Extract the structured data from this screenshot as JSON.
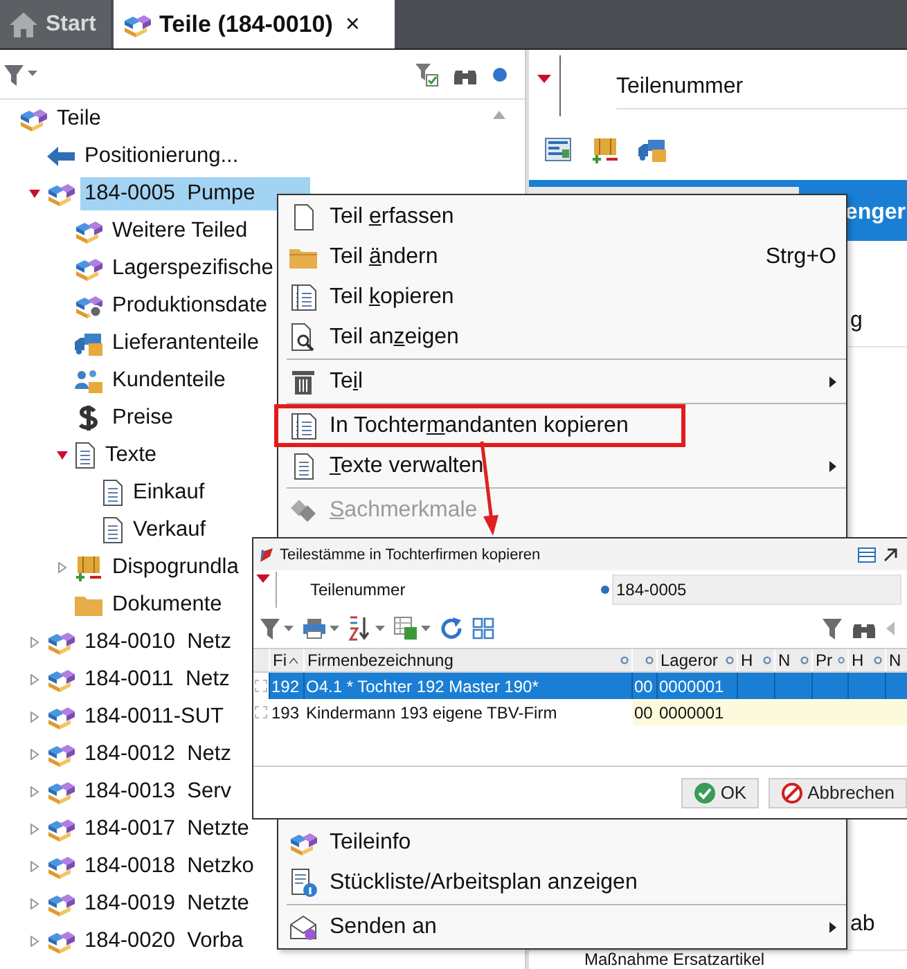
{
  "tabs": [
    {
      "label": "Start",
      "selected": false,
      "kind": "home"
    },
    {
      "label": "Teile (184-0010)",
      "selected": true,
      "kind": "parts",
      "close": "×"
    }
  ],
  "tree": {
    "root": {
      "label": "Teile",
      "kind": "part",
      "selected": false,
      "children": [
        {
          "label": "Positionierung...",
          "kind": "position",
          "selected": false
        },
        {
          "label": "184-0005  Pumpe",
          "kind": "part",
          "selected": true,
          "expanded": true,
          "children": [
            {
              "label": "Weitere Teiled",
              "kind": "part",
              "selected": false
            },
            {
              "label": "Lagerspezifische",
              "kind": "part",
              "selected": false
            },
            {
              "label": "Produktionsdate",
              "kind": "production",
              "selected": false
            },
            {
              "label": "Lieferantenteile",
              "kind": "supplier",
              "selected": false
            },
            {
              "label": "Kundenteile",
              "kind": "customer",
              "selected": false
            },
            {
              "label": "Preise",
              "kind": "prices",
              "selected": false
            },
            {
              "label": "Texte",
              "kind": "texts",
              "selected": false,
              "expanded": true,
              "children": [
                {
                  "label": "Einkauf",
                  "kind": "text",
                  "selected": false
                },
                {
                  "label": "Verkauf",
                  "kind": "text",
                  "selected": false
                }
              ]
            },
            {
              "label": "Dispogrundla",
              "kind": "dispo",
              "selected": false,
              "expanded": false
            },
            {
              "label": "Dokumente",
              "kind": "folder",
              "selected": false
            }
          ]
        },
        {
          "label": "184-0010  Netz",
          "kind": "part",
          "selected": false,
          "expanded": false
        },
        {
          "label": "184-0011  Netz",
          "kind": "part",
          "selected": false,
          "expanded": false
        },
        {
          "label": "184-0011-SUT",
          "kind": "part",
          "selected": false,
          "expanded": false
        },
        {
          "label": "184-0012  Netz",
          "kind": "part",
          "selected": false,
          "expanded": false
        },
        {
          "label": "184-0013  Serv",
          "kind": "part",
          "selected": false,
          "expanded": false
        },
        {
          "label": "184-0017  Netzte",
          "kind": "part",
          "selected": false,
          "expanded": false
        },
        {
          "label": "184-0018  Netzko",
          "kind": "part",
          "selected": false,
          "expanded": false
        },
        {
          "label": "184-0019  Netzte",
          "kind": "part",
          "selected": false,
          "expanded": false
        },
        {
          "label": "184-0020  Vorba",
          "kind": "part",
          "selected": false,
          "expanded": false
        }
      ]
    }
  },
  "detail": {
    "field_label": "Teilenummer",
    "header_text": "enger",
    "row_texts": [
      "g",
      "ab"
    ],
    "bottom_text": "Maßnahme Ersatzartikel"
  },
  "context_menu": {
    "upper_items": [
      {
        "kind": "new",
        "label": {
          "before": "Teil ",
          "key": "e",
          "after": "rfassen"
        },
        "disabled": false,
        "submenu": false,
        "marked": false
      },
      {
        "kind": "edit",
        "label": {
          "before": "Teil ",
          "key": "ä",
          "after": "ndern"
        },
        "shortcut": "Strg+O",
        "disabled": false,
        "submenu": false,
        "marked": false
      },
      {
        "kind": "copy",
        "label": {
          "before": "Teil ",
          "key": "k",
          "after": "opieren"
        },
        "disabled": false,
        "submenu": false,
        "marked": false
      },
      {
        "kind": "view",
        "label": {
          "before": "Teil an",
          "key": "z",
          "after": "eigen"
        },
        "disabled": false,
        "submenu": false,
        "marked": false
      },
      {
        "kind": "separator"
      },
      {
        "kind": "delete",
        "label": {
          "before": "Te",
          "key": "i",
          "after": "l"
        },
        "disabled": false,
        "submenu": true,
        "marked": false
      },
      {
        "kind": "separator"
      },
      {
        "kind": "copy-to",
        "label": {
          "before": "In Tochter",
          "key": "m",
          "after": "andanten kopieren"
        },
        "disabled": false,
        "submenu": false,
        "marked": true
      },
      {
        "kind": "texts",
        "label": {
          "key": "T",
          "after": "exte verwalten"
        },
        "disabled": false,
        "submenu": true,
        "marked": false
      },
      {
        "kind": "separator"
      },
      {
        "kind": "features",
        "label": {
          "key": "S",
          "after": "achmerkmale"
        },
        "disabled": true,
        "submenu": false,
        "marked": false
      }
    ],
    "lower_items": [
      {
        "kind": "info",
        "label": {
          "before": "Teileinfo"
        },
        "disabled": false,
        "submenu": false,
        "marked": false
      },
      {
        "kind": "bom",
        "label": {
          "before": "Stückliste/Arbeitsplan anzeigen"
        },
        "disabled": false,
        "submenu": false,
        "marked": false
      },
      {
        "kind": "separator"
      },
      {
        "kind": "send",
        "label": {
          "before": "Senden an"
        },
        "disabled": false,
        "submenu": true,
        "marked": false
      }
    ]
  },
  "dialog": {
    "title": "Teilestämme in Tochterfirmen kopieren",
    "field": {
      "label": "Teilenummer",
      "value": "184-0005"
    },
    "columns": [
      {
        "label": "Fi",
        "sorted": true,
        "filter": false
      },
      {
        "label": "Firmenbezeichnung",
        "sorted": false,
        "filter": true
      },
      {
        "sorted": false,
        "filter": true
      },
      {
        "label": "Lageror",
        "sorted": false,
        "filter": true
      },
      {
        "label": "H",
        "sorted": false,
        "filter": true
      },
      {
        "label": "N",
        "sorted": false,
        "filter": true
      },
      {
        "label": "Pr",
        "sorted": false,
        "filter": true
      },
      {
        "label": "H",
        "sorted": false,
        "filter": true
      },
      {
        "label": "N",
        "sorted": false,
        "filter": false
      }
    ],
    "rows": [
      {
        "selected": true,
        "cells": [
          "192",
          "O4.1 * Tochter 192 Master 190*",
          "00",
          "0000001"
        ]
      },
      {
        "selected": false,
        "cells": [
          "193",
          "Kindermann 193 eigene TBV-Firm",
          "00",
          "0000001"
        ]
      }
    ],
    "buttons": [
      {
        "label": "OK",
        "kind": "ok"
      },
      {
        "label": "Abbrechen",
        "kind": "cancel"
      }
    ]
  }
}
